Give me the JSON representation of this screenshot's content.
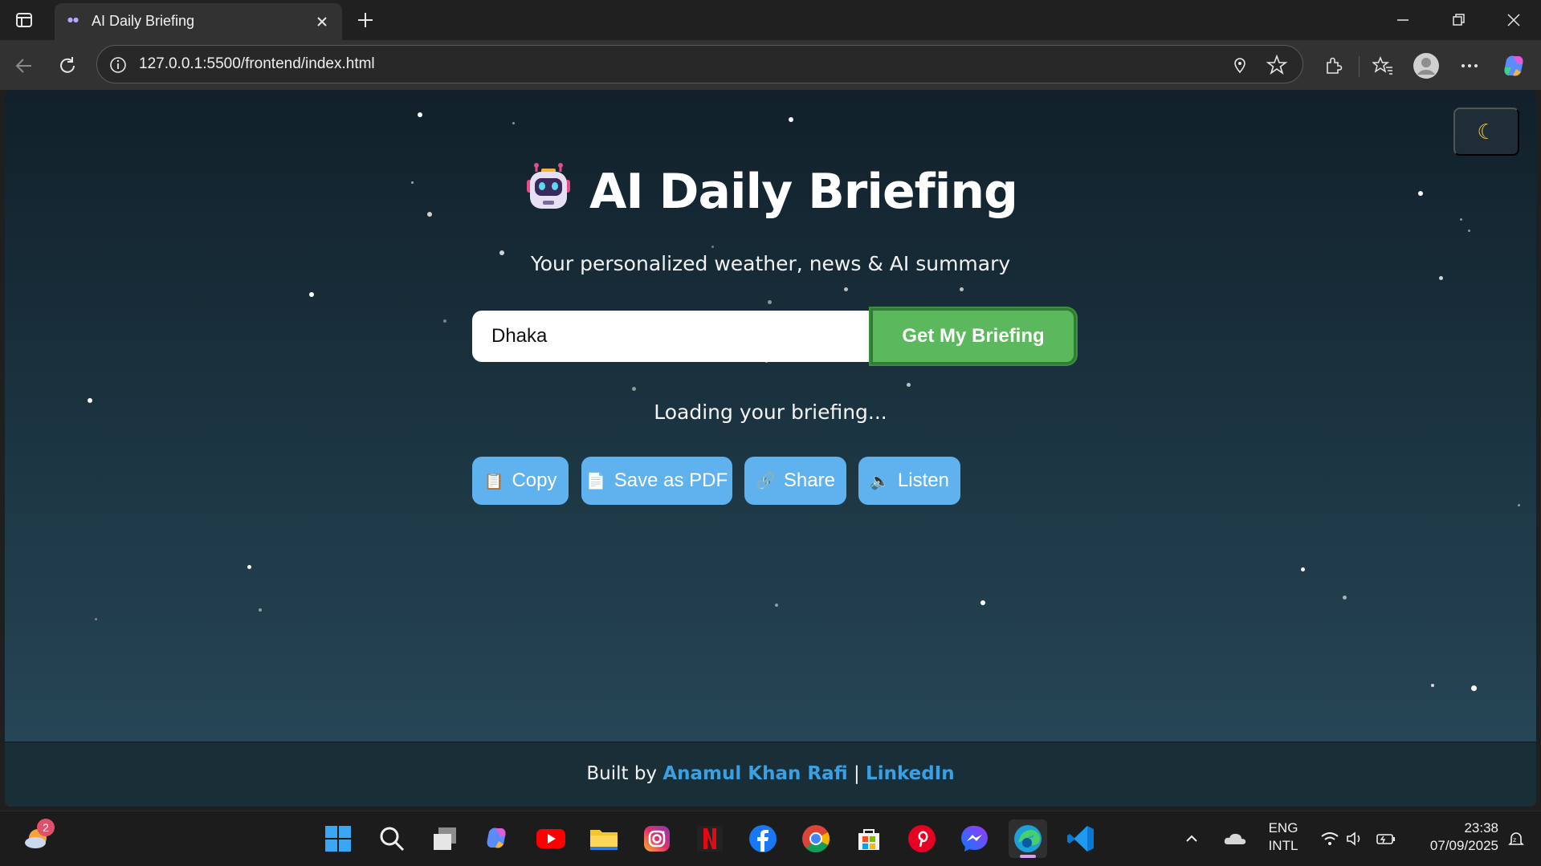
{
  "browser": {
    "tab_title": "AI Daily Briefing",
    "url": "127.0.0.1:5500/frontend/index.html"
  },
  "page": {
    "title": "AI Daily Briefing",
    "title_icon": "robot-icon",
    "subtitle": "Your personalized weather, news & AI summary",
    "theme_toggle_icon": "moon-icon",
    "city_input_value": "Dhaka",
    "submit_label": "Get My Briefing",
    "status": "Loading your briefing...",
    "actions": [
      {
        "label": "Copy",
        "icon": "clipboard-icon"
      },
      {
        "label": "Save as PDF",
        "icon": "document-icon"
      },
      {
        "label": "Share",
        "icon": "link-icon"
      },
      {
        "label": "Listen",
        "icon": "speaker-icon"
      }
    ],
    "footer": {
      "prefix": "Built by",
      "author": "Anamul Khan Rafi",
      "separator": "|",
      "link": "LinkedIn"
    }
  },
  "taskbar": {
    "weather_badge": "2",
    "lang_top": "ENG",
    "lang_bottom": "INTL",
    "time": "23:38",
    "date": "07/09/2025"
  },
  "colors": {
    "accent_green": "#5cb85c",
    "action_blue": "#5fb2ee",
    "link_blue": "#3aa0e4"
  }
}
